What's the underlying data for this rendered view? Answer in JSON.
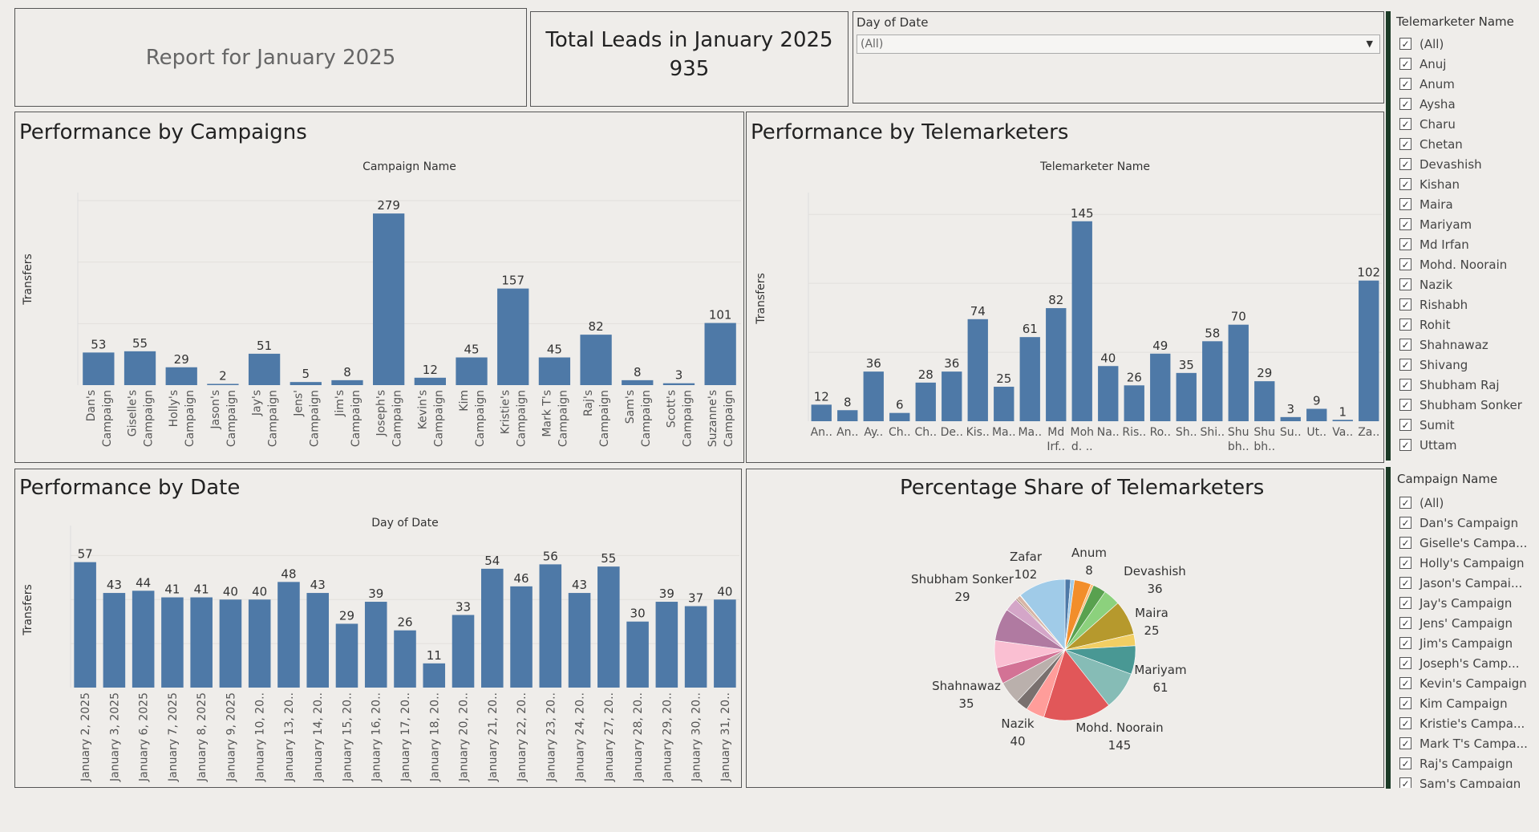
{
  "report_title": "Report for January 2025",
  "kpi": {
    "title": "Total Leads in January 2025",
    "value": "935"
  },
  "date_filter": {
    "label": "Day of Date",
    "value": "(All)"
  },
  "telemarketer_filter": {
    "title": "Telemarketer Name",
    "items": [
      "(All)",
      "Anuj",
      "Anum",
      "Aysha",
      "Charu",
      "Chetan",
      "Devashish",
      "Kishan",
      "Maira",
      "Mariyam",
      "Md Irfan",
      "Mohd. Noorain",
      "Nazik",
      "Rishabh",
      "Rohit",
      "Shahnawaz",
      "Shivang",
      "Shubham Raj",
      "Shubham Sonker",
      "Sumit",
      "Uttam"
    ]
  },
  "campaign_filter": {
    "title": "Campaign Name",
    "items": [
      "(All)",
      "Dan's Campaign",
      "Giselle's Campa...",
      "Holly's Campaign",
      "Jason's Campai...",
      "Jay's Campaign",
      "Jens' Campaign",
      "Jim's Campaign",
      "Joseph's Camp...",
      "Kevin's Campaign",
      "Kim Campaign",
      "Kristie's Campa...",
      "Mark T's Campa...",
      "Raj's Campaign",
      "Sam's Campaign"
    ]
  },
  "colors": {
    "bar": "#4e79a7",
    "background": "#efedea"
  },
  "chart_data": [
    {
      "type": "bar",
      "title": "Performance by Campaigns",
      "xlabel": "Campaign Name",
      "ylabel": "Transfers",
      "ylim": [
        0,
        300
      ],
      "categories": [
        [
          "Dan's",
          "Campaign"
        ],
        [
          "Giselle's",
          "Campaign"
        ],
        [
          "Holly's",
          "Campaign"
        ],
        [
          "Jason's",
          "Campaign"
        ],
        [
          "Jay's",
          "Campaign"
        ],
        [
          "Jens'",
          "Campaign"
        ],
        [
          "Jim's",
          "Campaign"
        ],
        [
          "Joseph's",
          "Campaign"
        ],
        [
          "Kevin's",
          "Campaign"
        ],
        [
          "Kim",
          "Campaign"
        ],
        [
          "Kristie's",
          "Campaign"
        ],
        [
          "Mark T's",
          "Campaign"
        ],
        [
          "Raj's",
          "Campaign"
        ],
        [
          "Sam's",
          "Campaign"
        ],
        [
          "Scott's",
          "Campaign"
        ],
        [
          "Suzanne's",
          "Campaign"
        ]
      ],
      "values": [
        53,
        55,
        29,
        2,
        51,
        5,
        8,
        279,
        12,
        45,
        157,
        45,
        82,
        8,
        3,
        101
      ]
    },
    {
      "type": "bar",
      "title": "Performance by Telemarketers",
      "xlabel": "Telemarketer Name",
      "ylabel": "Transfers",
      "ylim": [
        0,
        160
      ],
      "categories": [
        [
          "An.."
        ],
        [
          "An.."
        ],
        [
          "Ay.."
        ],
        [
          "Ch.."
        ],
        [
          "Ch.."
        ],
        [
          "De.."
        ],
        [
          "Kis.."
        ],
        [
          "Ma.."
        ],
        [
          "Ma.."
        ],
        [
          "Md",
          "Irf.."
        ],
        [
          "Moh",
          "d. .."
        ],
        [
          "Na.."
        ],
        [
          "Ris.."
        ],
        [
          "Ro.."
        ],
        [
          "Sh.."
        ],
        [
          "Shi.."
        ],
        [
          "Shu",
          "bh.."
        ],
        [
          "Shu",
          "bh.."
        ],
        [
          "Su.."
        ],
        [
          "Ut.."
        ],
        [
          "Va.."
        ],
        [
          "Za.."
        ]
      ],
      "values": [
        12,
        8,
        36,
        6,
        28,
        36,
        74,
        25,
        61,
        82,
        145,
        40,
        26,
        49,
        35,
        58,
        70,
        29,
        3,
        9,
        1,
        102
      ]
    },
    {
      "type": "bar",
      "title": "Performance by Date",
      "xlabel": "Day of Date",
      "ylabel": "Transfers",
      "ylim": [
        0,
        70
      ],
      "categories": [
        "January 2, 2025",
        "January 3, 2025",
        "January 6, 2025",
        "January 7, 2025",
        "January 8, 2025",
        "January 9, 2025",
        "January 10, 20..",
        "January 13, 20..",
        "January 14, 20..",
        "January 15, 20..",
        "January 16, 20..",
        "January 17, 20..",
        "January 18, 20..",
        "January 20, 20..",
        "January 21, 20..",
        "January 22, 20..",
        "January 23, 20..",
        "January 24, 20..",
        "January 27, 20..",
        "January 28, 20..",
        "January 29, 20..",
        "January 30, 20..",
        "January 31, 20.."
      ],
      "values": [
        57,
        43,
        44,
        41,
        41,
        40,
        40,
        48,
        43,
        29,
        39,
        26,
        11,
        33,
        54,
        46,
        56,
        43,
        55,
        30,
        39,
        37,
        40
      ]
    },
    {
      "type": "pie",
      "title": "Percentage Share of Telemarketers",
      "slices": [
        {
          "name": "Anuj",
          "value": 12,
          "color": "#4e79a7"
        },
        {
          "name": "Anum",
          "value": 8,
          "color": "#a0cbe8"
        },
        {
          "name": "Aysha",
          "value": 36,
          "color": "#f28e2b"
        },
        {
          "name": "Charu",
          "value": 6,
          "color": "#ffbe7d"
        },
        {
          "name": "Chetan",
          "value": 28,
          "color": "#59a14f"
        },
        {
          "name": "Devashish",
          "value": 36,
          "color": "#8cd17d"
        },
        {
          "name": "Kishan",
          "value": 74,
          "color": "#b6992d"
        },
        {
          "name": "Maira",
          "value": 25,
          "color": "#f1ce63"
        },
        {
          "name": "Mariyam",
          "value": 61,
          "color": "#499894"
        },
        {
          "name": "Md Irfan",
          "value": 82,
          "color": "#86bcb6"
        },
        {
          "name": "Mohd. Noorain",
          "value": 145,
          "color": "#e15759"
        },
        {
          "name": "Nazik",
          "value": 40,
          "color": "#ff9d9a"
        },
        {
          "name": "Rishabh",
          "value": 26,
          "color": "#79706e"
        },
        {
          "name": "Rohit",
          "value": 49,
          "color": "#bab0ac"
        },
        {
          "name": "Shahnawaz",
          "value": 35,
          "color": "#d37295"
        },
        {
          "name": "Shivang",
          "value": 58,
          "color": "#fabfd2"
        },
        {
          "name": "Shubham Raj",
          "value": 70,
          "color": "#b07aa1"
        },
        {
          "name": "Shubham Sonker",
          "value": 29,
          "color": "#d4a6c8"
        },
        {
          "name": "Sumit",
          "value": 3,
          "color": "#9d7660"
        },
        {
          "name": "Uttam",
          "value": 9,
          "color": "#d7b5a6"
        },
        {
          "name": "Va..",
          "value": 1,
          "color": "#bfbb60"
        },
        {
          "name": "Zafar",
          "value": 102,
          "color": "#a0cbe8"
        }
      ],
      "labels": [
        {
          "name": "Zafar",
          "value": "102"
        },
        {
          "name": "Anum",
          "value": "8"
        },
        {
          "name": "Devashish",
          "value": "36"
        },
        {
          "name": "Maira",
          "value": "25"
        },
        {
          "name": "Mariyam",
          "value": "61"
        },
        {
          "name": "Mohd. Noorain",
          "value": "145"
        },
        {
          "name": "Nazik",
          "value": "40"
        },
        {
          "name": "Shahnawaz",
          "value": "35"
        },
        {
          "name": "Shubham Sonker",
          "value": "29"
        }
      ]
    }
  ]
}
